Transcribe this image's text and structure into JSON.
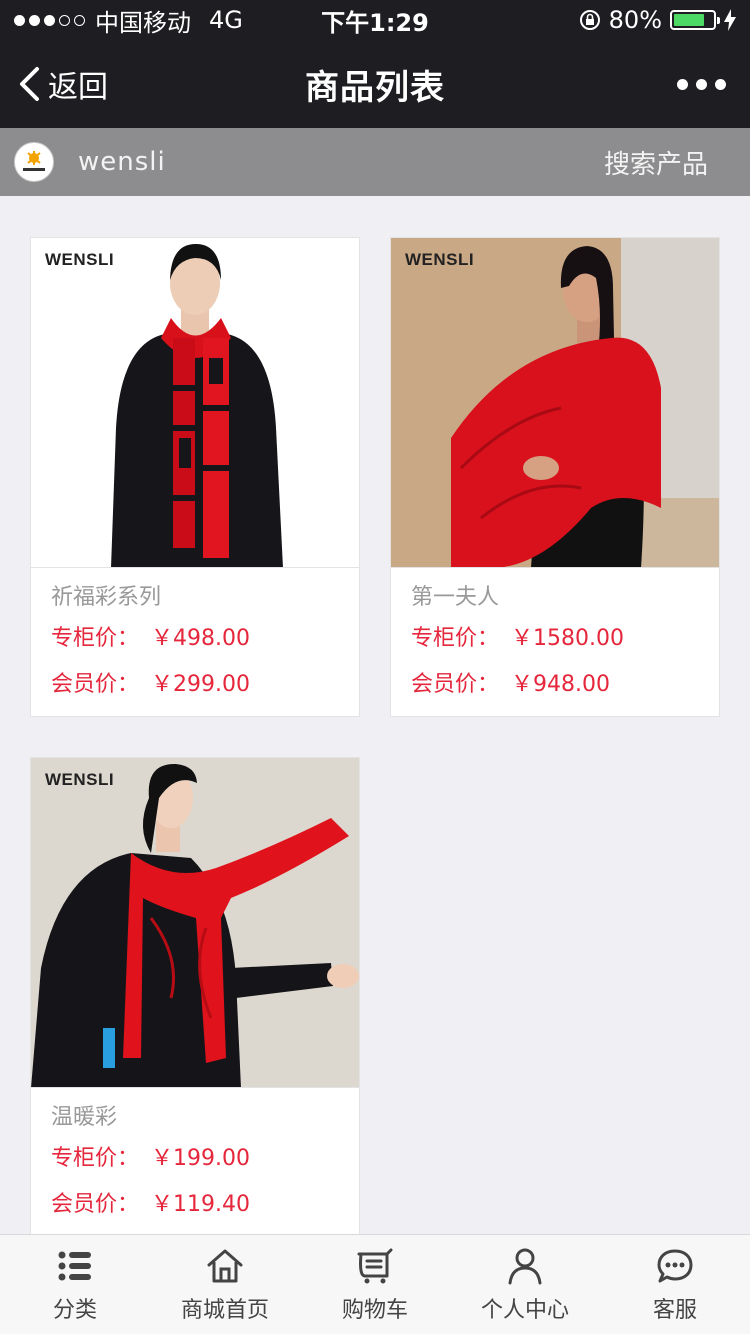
{
  "status_bar": {
    "carrier": "中国移动",
    "network": "4G",
    "time": "下午1:29",
    "battery_text": "80%",
    "battery_level": 0.8,
    "signal_strength": 3
  },
  "nav": {
    "back_label": "返回",
    "title": "商品列表"
  },
  "store": {
    "name": "wensli",
    "search_label": "搜索产品"
  },
  "price_labels": {
    "counter": "专柜价：",
    "member": "会员价："
  },
  "products": [
    {
      "brand": "WENSLI",
      "name": "祈福彩系列",
      "counter_price": "￥498.00",
      "member_price": "￥299.00"
    },
    {
      "brand": "WENSLI",
      "name": "第一夫人",
      "counter_price": "￥1580.00",
      "member_price": "￥948.00"
    },
    {
      "brand": "WENSLI",
      "name": "温暖彩",
      "counter_price": "￥199.00",
      "member_price": "￥119.40"
    }
  ],
  "tabs": [
    {
      "label": "分类",
      "icon": "list-icon"
    },
    {
      "label": "商城首页",
      "icon": "home-icon"
    },
    {
      "label": "购物车",
      "icon": "cart-icon"
    },
    {
      "label": "个人中心",
      "icon": "person-icon"
    },
    {
      "label": "客服",
      "icon": "chat-icon"
    }
  ],
  "colors": {
    "price_red": "#e5263b",
    "nav_bg": "#1e1e22",
    "store_bar_bg": "#8d8d8f",
    "battery_green": "#4cd964"
  }
}
